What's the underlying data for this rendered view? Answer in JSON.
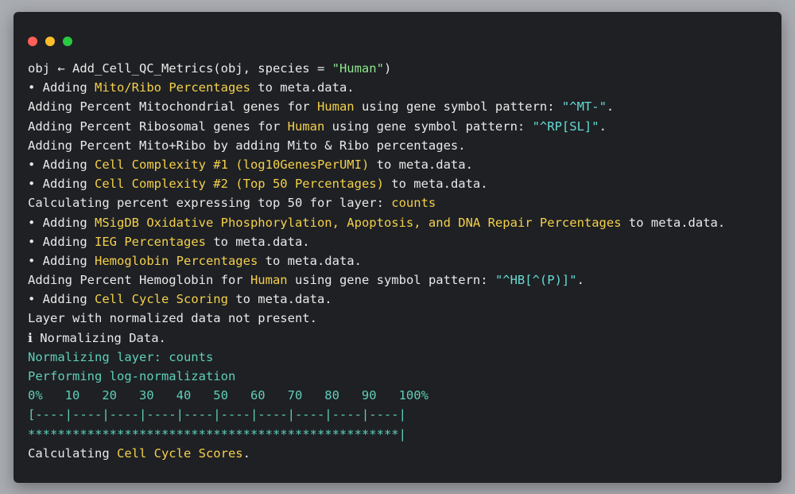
{
  "window": {
    "buttons": {
      "close": "red",
      "minimize": "yellow",
      "zoom": "green"
    }
  },
  "colors": {
    "background": "#1e2024",
    "text": "#e9e9e9",
    "highlight": "#f4d04a",
    "cyan": "#67dbd3",
    "green": "#8fe58f",
    "teal": "#5fcfb8"
  },
  "lines": [
    {
      "segments": [
        {
          "text": "obj ← Add_Cell_QC_Metrics(obj, species = ",
          "color": "w"
        },
        {
          "text": "\"Human\"",
          "color": "g"
        },
        {
          "text": ")",
          "color": "w"
        }
      ]
    },
    {
      "segments": [
        {
          "text": "• Adding ",
          "color": "w"
        },
        {
          "text": "Mito/Ribo Percentages",
          "color": "y"
        },
        {
          "text": " to meta.data.",
          "color": "w"
        }
      ]
    },
    {
      "segments": [
        {
          "text": "Adding Percent Mitochondrial genes for ",
          "color": "w"
        },
        {
          "text": "Human",
          "color": "y"
        },
        {
          "text": " using gene symbol pattern: ",
          "color": "w"
        },
        {
          "text": "\"^MT-\"",
          "color": "c"
        },
        {
          "text": ".",
          "color": "w"
        }
      ]
    },
    {
      "segments": [
        {
          "text": "Adding Percent Ribosomal genes for ",
          "color": "w"
        },
        {
          "text": "Human",
          "color": "y"
        },
        {
          "text": " using gene symbol pattern: ",
          "color": "w"
        },
        {
          "text": "\"^RP[SL]\"",
          "color": "c"
        },
        {
          "text": ".",
          "color": "w"
        }
      ]
    },
    {
      "segments": [
        {
          "text": "Adding Percent Mito+Ribo by adding Mito & Ribo percentages.",
          "color": "w"
        }
      ]
    },
    {
      "segments": [
        {
          "text": "• Adding ",
          "color": "w"
        },
        {
          "text": "Cell Complexity #1 (log10GenesPerUMI)",
          "color": "y"
        },
        {
          "text": " to meta.data.",
          "color": "w"
        }
      ]
    },
    {
      "segments": [
        {
          "text": "• Adding ",
          "color": "w"
        },
        {
          "text": "Cell Complexity #2 (Top 50 Percentages)",
          "color": "y"
        },
        {
          "text": " to meta.data.",
          "color": "w"
        }
      ]
    },
    {
      "segments": [
        {
          "text": "Calculating percent expressing top 50 for layer: ",
          "color": "w"
        },
        {
          "text": "counts",
          "color": "y"
        }
      ]
    },
    {
      "segments": [
        {
          "text": "• Adding ",
          "color": "w"
        },
        {
          "text": "MSigDB Oxidative Phosphorylation, Apoptosis, and DNA Repair Percentages",
          "color": "y"
        },
        {
          "text": " to meta.data.",
          "color": "w"
        }
      ]
    },
    {
      "segments": [
        {
          "text": "• Adding ",
          "color": "w"
        },
        {
          "text": "IEG Percentages",
          "color": "y"
        },
        {
          "text": " to meta.data.",
          "color": "w"
        }
      ]
    },
    {
      "segments": [
        {
          "text": "• Adding ",
          "color": "w"
        },
        {
          "text": "Hemoglobin Percentages",
          "color": "y"
        },
        {
          "text": " to meta.data.",
          "color": "w"
        }
      ]
    },
    {
      "segments": [
        {
          "text": "Adding Percent Hemoglobin for ",
          "color": "w"
        },
        {
          "text": "Human",
          "color": "y"
        },
        {
          "text": " using gene symbol pattern: ",
          "color": "w"
        },
        {
          "text": "\"^HB[^(P)]\"",
          "color": "c"
        },
        {
          "text": ".",
          "color": "w"
        }
      ]
    },
    {
      "segments": [
        {
          "text": "• Adding ",
          "color": "w"
        },
        {
          "text": "Cell Cycle Scoring",
          "color": "y"
        },
        {
          "text": " to meta.data.",
          "color": "w"
        }
      ]
    },
    {
      "segments": [
        {
          "text": "Layer with normalized data not present.",
          "color": "w"
        }
      ]
    },
    {
      "segments": [
        {
          "text": "ℹ Normalizing Data.",
          "color": "w"
        }
      ]
    },
    {
      "segments": [
        {
          "text": "Normalizing layer: counts",
          "color": "t"
        }
      ]
    },
    {
      "segments": [
        {
          "text": "Performing log-normalization",
          "color": "t"
        }
      ]
    },
    {
      "segments": [
        {
          "text": "0%   10   20   30   40   50   60   70   80   90   100%",
          "color": "t"
        }
      ]
    },
    {
      "segments": [
        {
          "text": "[----|----|----|----|----|----|----|----|----|----|",
          "color": "t"
        }
      ]
    },
    {
      "segments": [
        {
          "text": "**************************************************|",
          "color": "t"
        }
      ]
    },
    {
      "segments": [
        {
          "text": "Calculating ",
          "color": "w"
        },
        {
          "text": "Cell Cycle Scores",
          "color": "y"
        },
        {
          "text": ".",
          "color": "w"
        }
      ]
    }
  ]
}
